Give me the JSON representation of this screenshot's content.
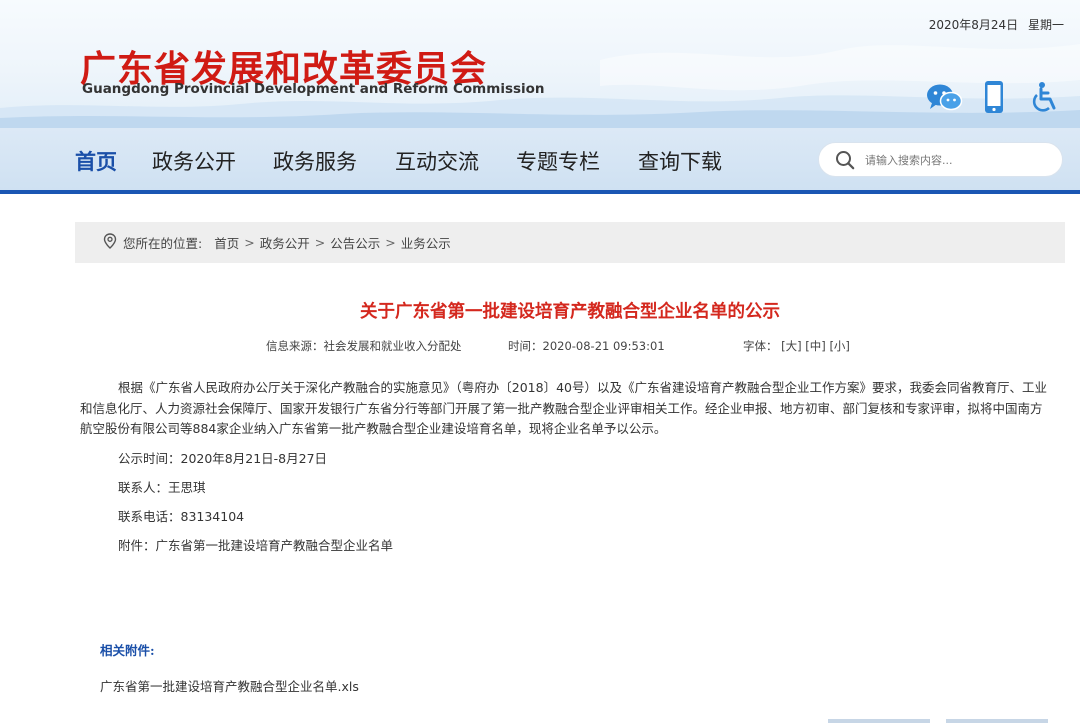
{
  "header": {
    "date": "2020年8月24日",
    "weekday": "星期一",
    "site_title_cn": "广东省发展和改革委员会",
    "site_title_en": "Guangdong Provincial Development and Reform Commission",
    "icons": [
      "wechat-icon",
      "mobile-icon",
      "accessibility-icon"
    ]
  },
  "nav": {
    "items": [
      "首页",
      "政务公开",
      "政务服务",
      "互动交流",
      "专题专栏",
      "查询下载"
    ],
    "active_index": 0
  },
  "search": {
    "placeholder": "请输入搜索内容..."
  },
  "breadcrumb": {
    "label": "您所在的位置:",
    "items": [
      "首页",
      "政务公开",
      "公告公示",
      "业务公示"
    ],
    "separator": ">"
  },
  "article": {
    "title": "关于广东省第一批建设培育产教融合型企业名单的公示",
    "source": "信息来源：社会发展和就业收入分配处",
    "time": "时间：2020-08-21 09:53:01",
    "font_label": "字体：",
    "font_large": "[大]",
    "font_medium": "[中]",
    "font_small": "[小]",
    "paragraph": "根据《广东省人民政府办公厅关于深化产教融合的实施意见》（粤府办〔2018〕40号）以及《广东省建设培育产教融合型企业工作方案》要求，我委会同省教育厅、工业和信息化厅、人力资源社会保障厅、国家开发银行广东省分行等部门开展了第一批产教融合型企业评审相关工作。经企业申报、地方初审、部门复核和专家评审，拟将中国南方航空股份有限公司等884家企业纳入广东省第一批产教融合型企业建设培育名单，现将企业名单予以公示。",
    "publicity_period": "公示时间：2020年8月21日-8月27日",
    "contact": "联系人：王思琪",
    "phone": "联系电话：83134104",
    "attachment": "附件：广东省第一批建设培育产教融合型企业名单"
  },
  "related": {
    "heading": "相关附件:",
    "file": "广东省第一批建设培育产教融合型企业名单.xls"
  },
  "colors": {
    "title_red": "#d01b14",
    "nav_active": "#1a4fa8",
    "nav_border": "#1a56b3",
    "article_title": "#d4281e"
  }
}
